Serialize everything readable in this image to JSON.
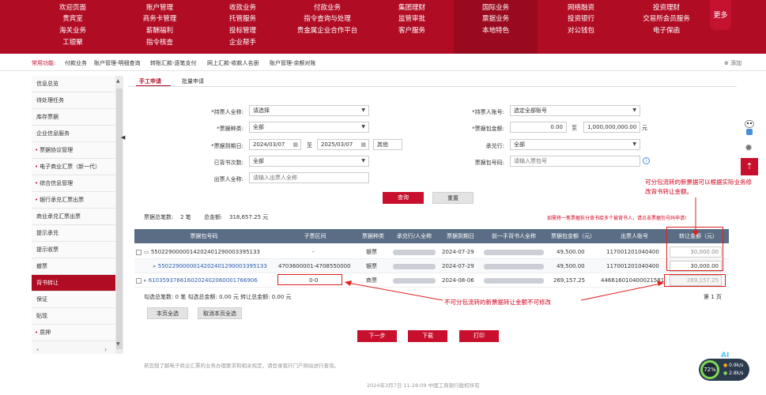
{
  "top_nav": {
    "rows": [
      [
        "欢迎页面",
        "账户管理",
        "收款业务",
        "付款业务",
        "集团理财",
        "国际业务",
        "网络融资",
        "投资理财"
      ],
      [
        "贵宾室",
        "商务卡管理",
        "托管服务",
        "指令查询与处理",
        "监管审批",
        "票据业务",
        "投资银行",
        "交易所会员服务"
      ],
      [
        "海关业务",
        "薪酬福利",
        "投标管理",
        "贵金属企业合作平台",
        "客户服务",
        "本地特色",
        "对公钱包",
        "电子保函"
      ],
      [
        "工银聚",
        "指令核查",
        "企业帮手"
      ]
    ],
    "more": "更多"
  },
  "quick_bar": {
    "label": "常用功能:",
    "items": [
      "付款业务",
      "账户管理-明细查询",
      "转账汇款-逐笔支付",
      "网上汇款-收款人名册",
      "账户管理-余额对账"
    ],
    "add": "⊕ 添加"
  },
  "sidebar": {
    "items": [
      {
        "label": "信息总览",
        "marker": ""
      },
      {
        "label": "待处理任务",
        "marker": ""
      },
      {
        "label": "库存票据",
        "marker": ""
      },
      {
        "label": "企业信息服务",
        "marker": ""
      },
      {
        "label": "票据协议管理",
        "marker": "•"
      },
      {
        "label": "电子商业汇票（新一代）",
        "marker": "•"
      },
      {
        "label": "综合信息管理",
        "marker": "•"
      },
      {
        "label": "银行承兑汇票出票",
        "marker": "•"
      },
      {
        "label": "商业承兑汇票出票",
        "marker": ""
      },
      {
        "label": "提示承兑",
        "marker": ""
      },
      {
        "label": "提示收票",
        "marker": ""
      },
      {
        "label": "撤票",
        "marker": ""
      },
      {
        "label": "背书转让",
        "marker": "",
        "active": true
      },
      {
        "label": "保证",
        "marker": ""
      },
      {
        "label": "贴现",
        "marker": ""
      },
      {
        "label": "质押",
        "marker": "•"
      }
    ]
  },
  "tabs": [
    "手工申请",
    "批量申请"
  ],
  "form": {
    "holder_name_label": "*持票人全称:",
    "holder_name_value": "请选择",
    "holder_account_label": "*持票人账号:",
    "holder_account_value": "选定全部账号",
    "bill_type_label": "*票据种类:",
    "bill_type_value": "全部",
    "amount_label": "*票据包金额:",
    "amount_from": "0.00",
    "amount_sep": "至",
    "amount_to": "1,000,000,000.00",
    "amount_unit": "元",
    "due_label": "*票据到期日:",
    "due_from": "2024/03/07",
    "due_sep": "至",
    "due_to": "2025/03/07",
    "due_other": "其他",
    "acceptor_label": "承兑行:",
    "acceptor_value": "全部",
    "endorse_times_label": "已背书次数:",
    "endorse_times_value": "全部",
    "bill_no_label": "票据包号码:",
    "bill_no_placeholder": "请输入票包号",
    "drawer_label": "出票人全称:",
    "drawer_placeholder": "请输入出票人全称",
    "query": "查询",
    "reset": "重置"
  },
  "summary": {
    "count_label": "票据总笔数:",
    "count": "2 笔",
    "amount_label": "总金额:",
    "amount": "318,657.25 元",
    "note": "如需将一笔票据拆分背书给多个被背书人，请点击票据包号码申请!"
  },
  "table": {
    "headers": [
      "票据包号码",
      "子票区间",
      "票据种类",
      "承兑行/人全称",
      "票据到期日",
      "前一手背书人全称",
      "票据包金额（元）",
      "出票人账号",
      "转让金额（元）"
    ],
    "rows": [
      {
        "no": "5502290000014202401290003395133",
        "range": "-",
        "type": "银票",
        "due": "2024-07-29",
        "amount": "49,500.00",
        "account": "117001201040400",
        "transfer": "30,000.00"
      },
      {
        "no": "5502290000014202401290003395133",
        "range": "4703600001-4708550000",
        "type": "银票",
        "due": "2024-07-29",
        "amount": "49,500.00",
        "account": "117001201040400",
        "transfer": "30,000.00"
      },
      {
        "no": "6103593766160202402060001766906",
        "range": "0-0",
        "type": "商票",
        "due": "2024-08-06",
        "amount": "269,157.25",
        "account": "446616010400021581",
        "transfer": "269,157.25"
      }
    ]
  },
  "selection": {
    "text": "勾选总笔数:  0 笔  勾选总金额:  0.00 元  转让总金额:  0.00 元",
    "page": "第 1 页",
    "select_all": "本页全选",
    "deselect_all": "取消本页全选"
  },
  "actions": {
    "next": "下一步",
    "download": "下载",
    "print": "打印"
  },
  "annotations": {
    "top": "可分包流转的新票据可以根据实际业务修改背书转让金额。",
    "bottom": "不可分包流转的新票据转让金额不可修改"
  },
  "footer": {
    "help": "若您想了解电子商业汇票的业务办理要求和相关规定，请登录我行门户网站进行查询。",
    "copyright": "2024年3月7日 11:28:09  中国工商银行版权所有"
  },
  "widget": {
    "percent": "72%",
    "up": "0.9k/s",
    "down": "2.8k/s",
    "ai": "AI"
  }
}
